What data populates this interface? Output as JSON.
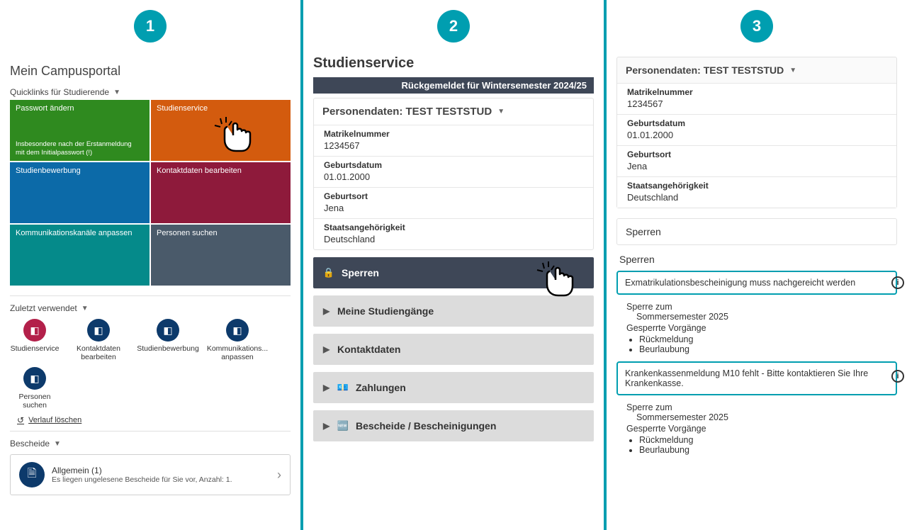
{
  "steps": {
    "one": "1",
    "two": "2",
    "three": "3"
  },
  "panel1": {
    "title": "Mein Campusportal",
    "quicklinks_header": "Quicklinks für Studierende",
    "tiles": {
      "t0": {
        "title": "Passwort ändern",
        "sub": "Insbesondere nach der Erstanmeldung mit dem Initialpasswort (!)"
      },
      "t1": {
        "title": "Studienservice",
        "sub": ""
      },
      "t2": {
        "title": "Studienbewerbung",
        "sub": ""
      },
      "t3": {
        "title": "Kontaktdaten bearbeiten",
        "sub": ""
      },
      "t4": {
        "title": "Kommunikationskanäle anpassen",
        "sub": ""
      },
      "t5": {
        "title": "Personen suchen",
        "sub": ""
      }
    },
    "recent_header": "Zuletzt verwendet",
    "recent": {
      "r0": "Studienservice",
      "r1": "Kontaktdaten bearbeiten",
      "r2": "Studienbewerbung",
      "r3": "Kommunikations... anpassen",
      "r4": "Personen suchen"
    },
    "clear_history": "Verlauf löschen",
    "bescheide_header": "Bescheide",
    "bescheide_item_title": "Allgemein (1)",
    "bescheide_item_sub": "Es liegen ungelesene Bescheide für Sie vor, Anzahl: 1."
  },
  "panel2": {
    "title": "Studienservice",
    "status_bar": "Rückgemeldet für Wintersemester 2024/25",
    "persondata_header": "Personendaten: TEST TESTSTUD",
    "fields": {
      "matrikel_label": "Matrikelnummer",
      "matrikel_value": "1234567",
      "dob_label": "Geburtsdatum",
      "dob_value": "01.01.2000",
      "pob_label": "Geburtsort",
      "pob_value": "Jena",
      "nat_label": "Staatsangehörigkeit",
      "nat_value": "Deutschland"
    },
    "acc": {
      "sperren": "Sperren",
      "studiengaenge": "Meine Studiengänge",
      "kontakt": "Kontaktdaten",
      "zahlungen": "Zahlungen",
      "bescheide": "Bescheide / Bescheinigungen"
    }
  },
  "panel3": {
    "persondata_header": "Personendaten: TEST TESTSTUD",
    "fields": {
      "matrikel_label": "Matrikelnummer",
      "matrikel_value": "1234567",
      "dob_label": "Geburtsdatum",
      "dob_value": "01.01.2000",
      "pob_label": "Geburtsort",
      "pob_value": "Jena",
      "nat_label": "Staatsangehörigkeit",
      "nat_value": "Deutschland"
    },
    "sperren_heading": "Sperren",
    "sperren_label": "Sperren",
    "info_glyph": "i",
    "sperre1": {
      "title": "Exmatrikulationsbescheinigung muss nachgereicht werden",
      "zum_label": "Sperre zum",
      "zum_value": "Sommersemester 2025",
      "vorg_label": "Gesperrte Vorgänge",
      "v1": "Rückmeldung",
      "v2": "Beurlaubung"
    },
    "sperre2": {
      "title": "Krankenkassenmeldung M10 fehlt - Bitte kontaktieren Sie Ihre Krankenkasse.",
      "zum_label": "Sperre zum",
      "zum_value": "Sommersemester 2025",
      "vorg_label": "Gesperrte Vorgänge",
      "v1": "Rückmeldung",
      "v2": "Beurlaubung"
    }
  }
}
